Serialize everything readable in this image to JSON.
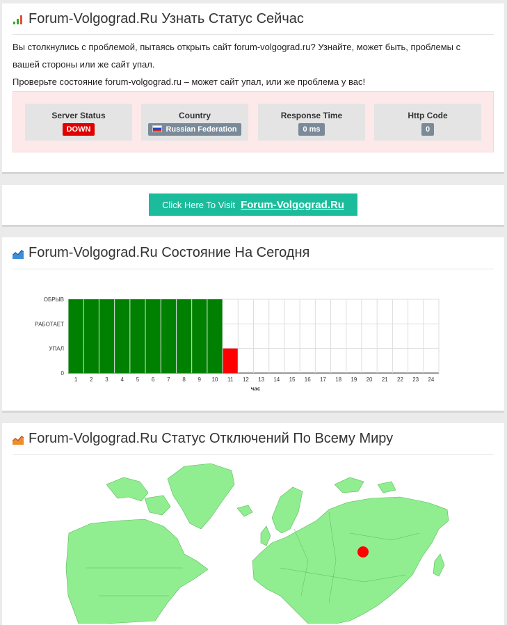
{
  "status_panel": {
    "title": "Forum-Volgograd.Ru Узнать Статус Сейчас",
    "desc_line1": "Вы столкнулись с проблемой, пытаясь открыть сайт forum-volgograd.ru? Узнайте, может быть, проблемы с",
    "desc_line2": "вашей стороны или же сайт упал.",
    "desc_line3": "Проверьте состояние forum-volgograd.ru – может сайт упал, или же проблема у вас!",
    "stats": [
      {
        "label": "Server Status",
        "value": "DOWN",
        "color": "#e00000"
      },
      {
        "label": "Country",
        "value": "Russian Federation",
        "color": "#7a8a99"
      },
      {
        "label": "Response Time",
        "value": "0 ms",
        "color": "#7a8a99"
      },
      {
        "label": "Http Code",
        "value": "0",
        "color": "#7a8a99"
      }
    ]
  },
  "visit": {
    "prefix": "Click Here To Visit",
    "site": "Forum-Volgograd.Ru",
    "color": "#1abc9c"
  },
  "today_panel": {
    "title": "Forum-Volgograd.Ru Состояние На Сегодня"
  },
  "world_panel": {
    "title": "Forum-Volgograd.Ru Статус Отключений По Всему Миру"
  },
  "chart_data": {
    "type": "bar",
    "xlabel": "час",
    "ylabel": "",
    "categories": [
      "1",
      "2",
      "3",
      "4",
      "5",
      "6",
      "7",
      "8",
      "9",
      "10",
      "11",
      "12",
      "13",
      "14",
      "15",
      "16",
      "17",
      "18",
      "19",
      "20",
      "21",
      "22",
      "23",
      "24"
    ],
    "y_levels": [
      "0",
      "УПАЛ",
      "РАБОТАЕТ",
      "ОБРЫВ"
    ],
    "values": [
      3,
      3,
      3,
      3,
      3,
      3,
      3,
      3,
      3,
      3,
      1,
      0,
      0,
      0,
      0,
      0,
      0,
      0,
      0,
      0,
      0,
      0,
      0,
      0
    ],
    "colors": [
      "#008000",
      "#008000",
      "#008000",
      "#008000",
      "#008000",
      "#008000",
      "#008000",
      "#008000",
      "#008000",
      "#008000",
      "#ff0000"
    ],
    "grid": true
  },
  "map": {
    "land_color": "#90ee90",
    "marker_color": "#ff0000"
  }
}
